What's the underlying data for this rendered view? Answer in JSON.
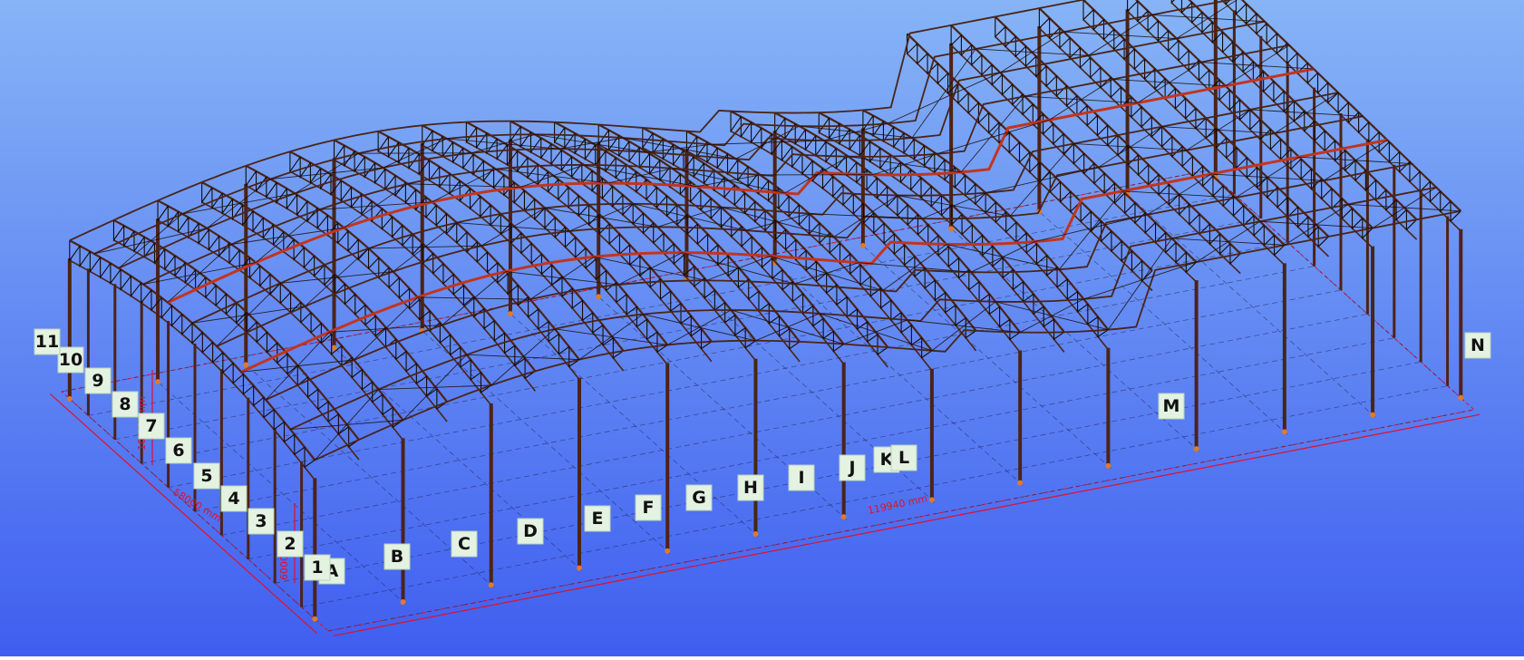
{
  "colors": {
    "background_top": "#86b4f6",
    "background_bottom": "#3f5ef0",
    "steel": "#4a2418",
    "steel_highlight": "#7a3b26",
    "purlin_red": "#c2351e",
    "dimension": "#e0112b",
    "grid_label_fill": "#e4f2e2"
  },
  "grid_labels_letters": [
    "A",
    "B",
    "C",
    "D",
    "E",
    "F",
    "G",
    "H",
    "I",
    "J",
    "K",
    "L",
    "M",
    "N"
  ],
  "grid_labels_numbers": [
    "1",
    "2",
    "3",
    "4",
    "5",
    "6",
    "7",
    "8",
    "9",
    "10",
    "11"
  ],
  "dimensions": {
    "length": "119940 mm",
    "width": "58000 mm",
    "height_upper": "10002 mm",
    "height_lower": "6000 mm"
  }
}
